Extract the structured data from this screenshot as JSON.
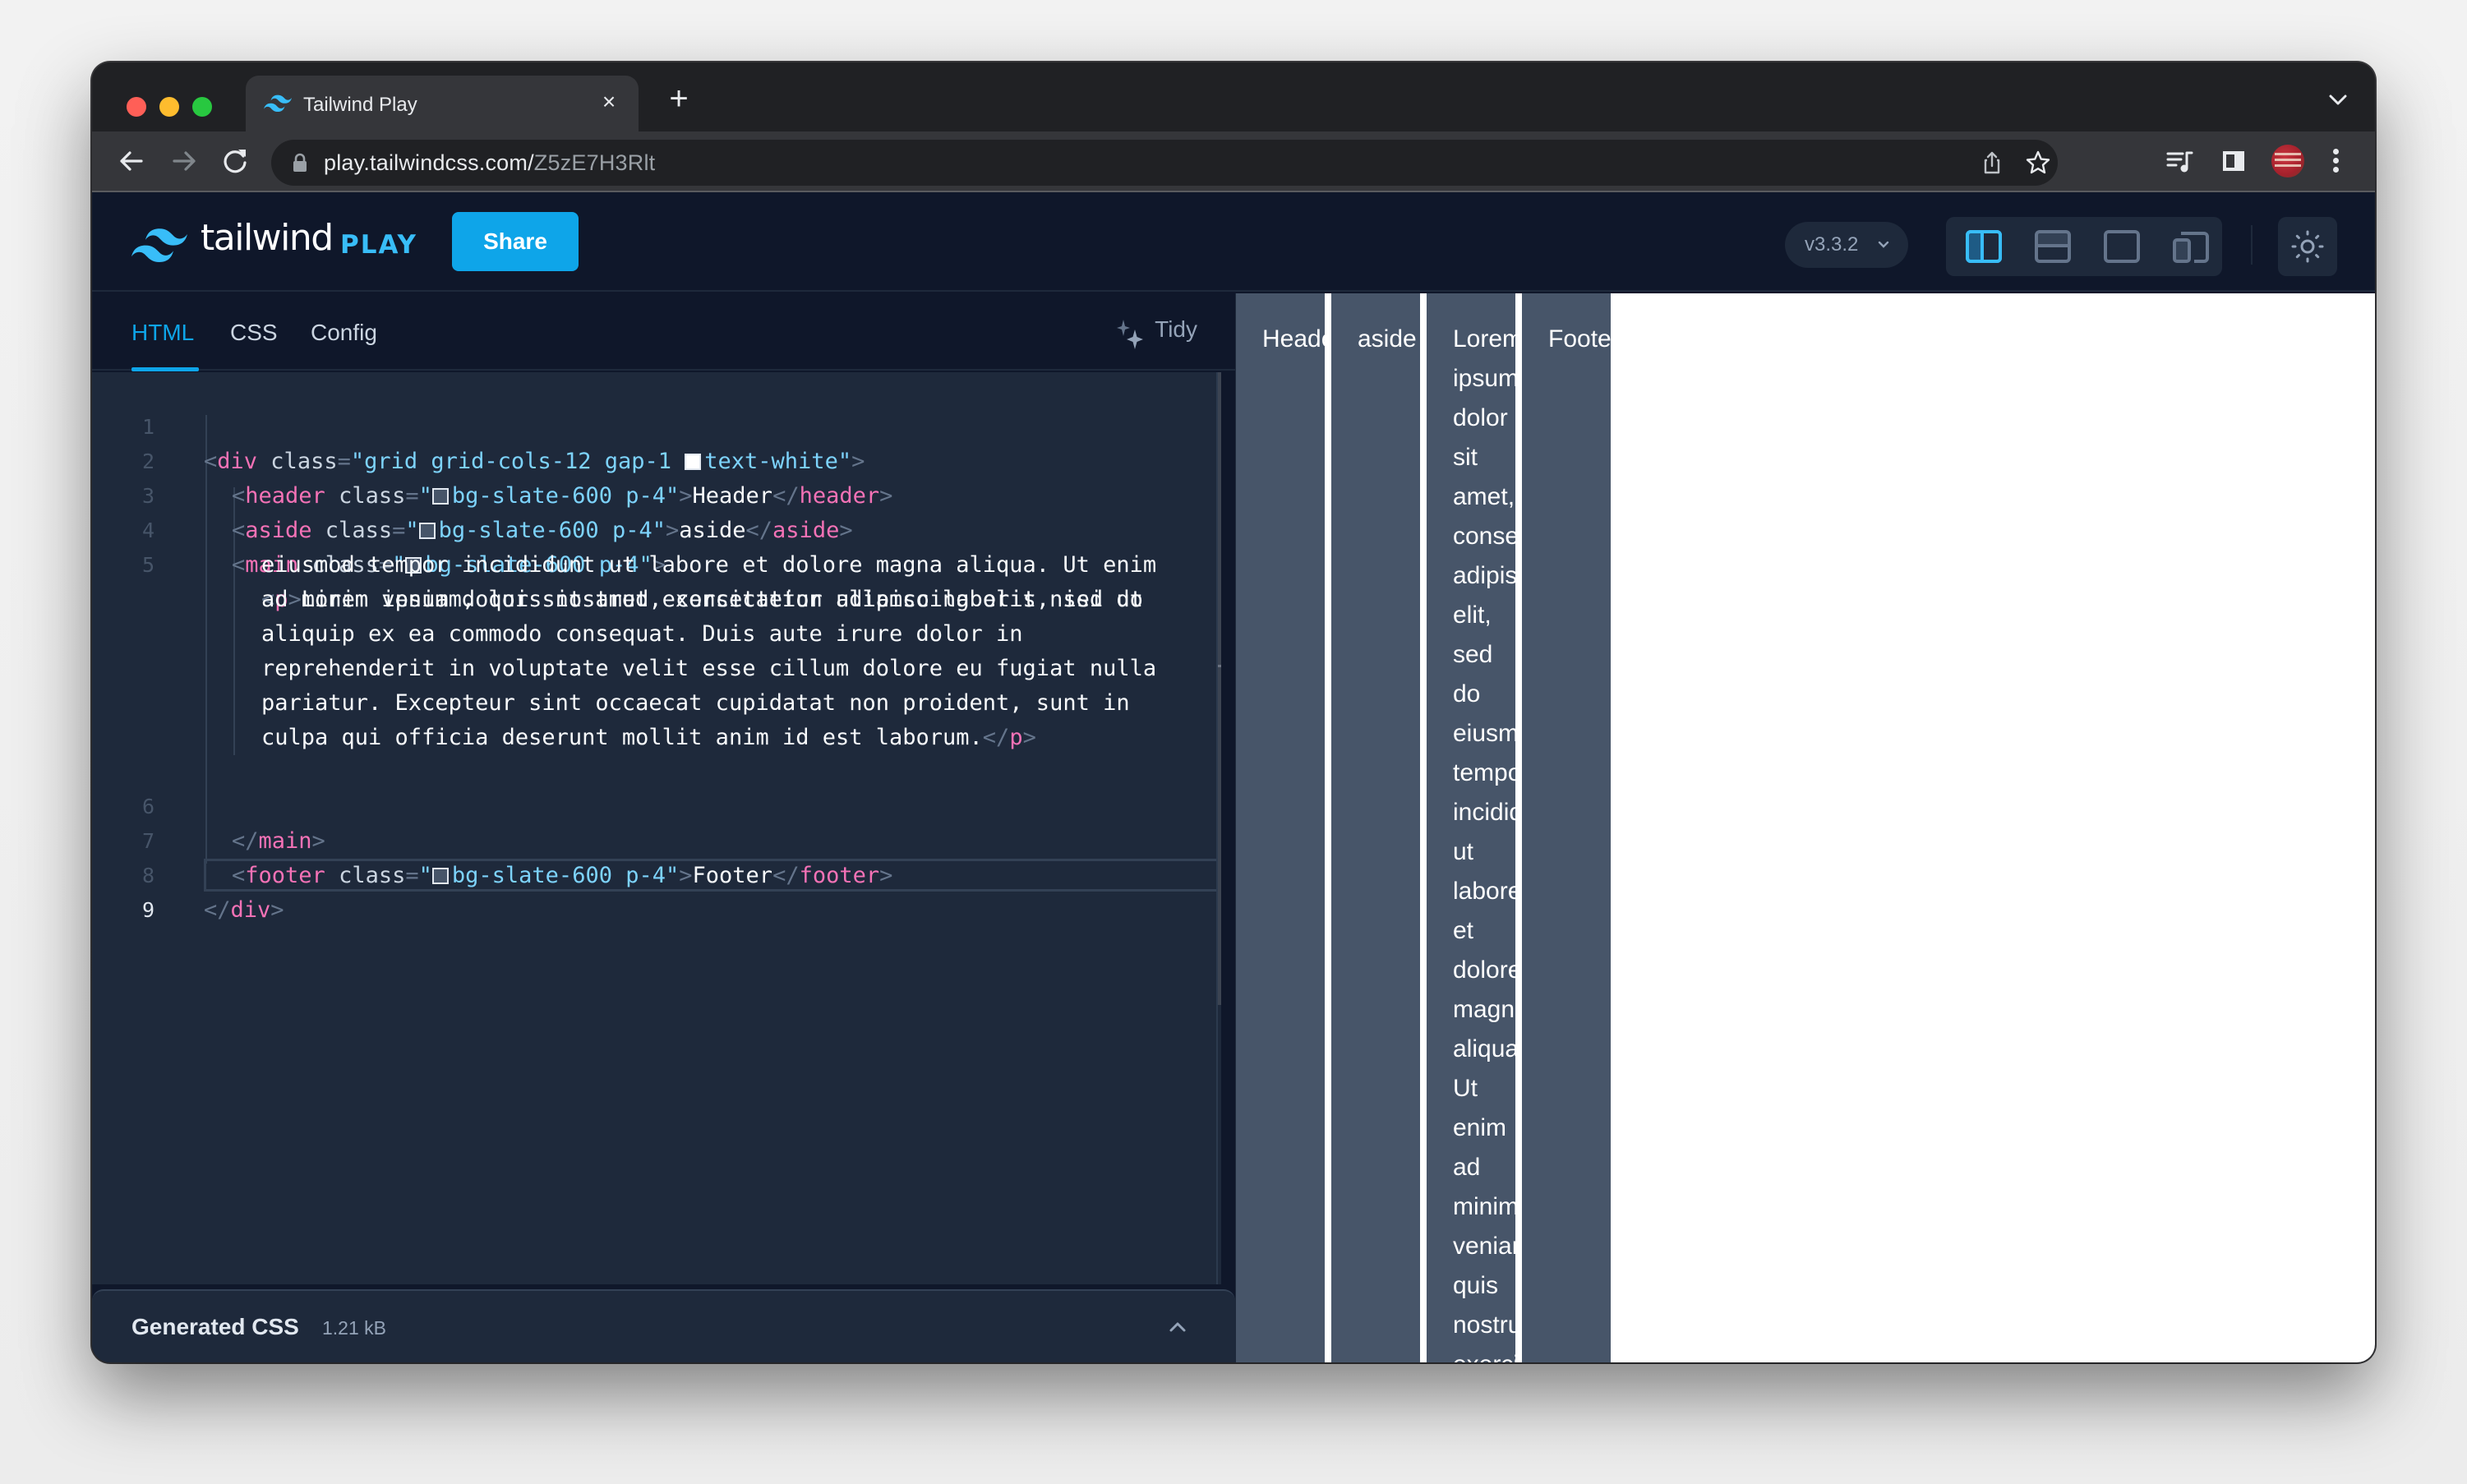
{
  "browser": {
    "tab_title": "Tailwind Play",
    "tab_close": "×",
    "new_tab": "+",
    "url_host": "play.tailwindcss.com/",
    "url_path": "Z5zE7H3Rlt"
  },
  "app": {
    "logo_text": "tailwind",
    "logo_play": "PLAY",
    "share_label": "Share",
    "version": "v3.3.2",
    "version_chevron": "⌄",
    "layouts": [
      "vertical-split",
      "horizontal-split",
      "preview-only",
      "responsive"
    ],
    "active_layout": "vertical-split",
    "accent": "#0ea5e9"
  },
  "editor": {
    "tabs": [
      {
        "label": "HTML",
        "active": true
      },
      {
        "label": "CSS",
        "active": false
      },
      {
        "label": "Config",
        "active": false
      }
    ],
    "tidy_label": "Tidy",
    "line_numbers": [
      "1",
      "2",
      "3",
      "4",
      "5",
      "6",
      "7",
      "8",
      "9"
    ],
    "code": {
      "l1": {
        "open": "<",
        "tag": "div",
        "attr": " class",
        "eq": "=",
        "q1": "\"",
        "val1": "grid grid-cols-12 gap-1 ",
        "val2": "text-white",
        "q2": "\"",
        "close": ">"
      },
      "l2": {
        "tag": "header",
        "attr": " class",
        "val": "bg-slate-600 p-4",
        "text": "Header"
      },
      "l3": {
        "tag": "aside",
        "attr": " class",
        "val": "bg-slate-600 p-4",
        "text": "aside"
      },
      "l4": {
        "tag": "main",
        "attr": " class",
        "val": "bg-slate-600 p-4"
      },
      "l5": {
        "tag": "p",
        "wrapped": [
          "Lorem ipsum dolor sit amet, consectetur adipiscing elit, sed do",
          "eiusmod tempor incididunt ut labore et dolore magna aliqua. Ut enim",
          "ad minim veniam, quis nostrud exercitation ullamco laboris nisi ut",
          "aliquip ex ea commodo consequat. Duis aute irure dolor in",
          "reprehenderit in voluptate velit esse cillum dolore eu fugiat nulla",
          "pariatur. Excepteur sint occaecat cupidatat non proident, sunt in",
          "culpa qui officia deserunt mollit anim id est laborum."
        ]
      },
      "l6": {
        "tag": "main"
      },
      "l7": {
        "tag": "footer",
        "attr": " class",
        "val": "bg-slate-600 p-4",
        "text": "Footer"
      },
      "l8": {
        "tag": "div"
      }
    }
  },
  "generated_css": {
    "title": "Generated CSS",
    "size": "1.21 kB",
    "toggle": "chevron-up"
  },
  "preview": {
    "header": "Header",
    "aside": "aside",
    "main": "Lorem ipsum dolor sit amet, consectetur adipiscing elit, sed do eiusmod tempor incididunt ut labore et dolore magna aliqua. Ut enim ad minim veniam, quis nostrud exercitation ullamco laboris nisi ut aliquip ex ea commodo consequat. Duis aute irure dolor in reprehenderit in voluptate velit esse cillum dolore eu fugiat nulla pariatur. Excepteur sint occaecat cupidatat non proident, sunt in culpa qui officia deserunt mollit anim id est laborum.",
    "footer": "Footer",
    "cell_color": "#475569"
  }
}
